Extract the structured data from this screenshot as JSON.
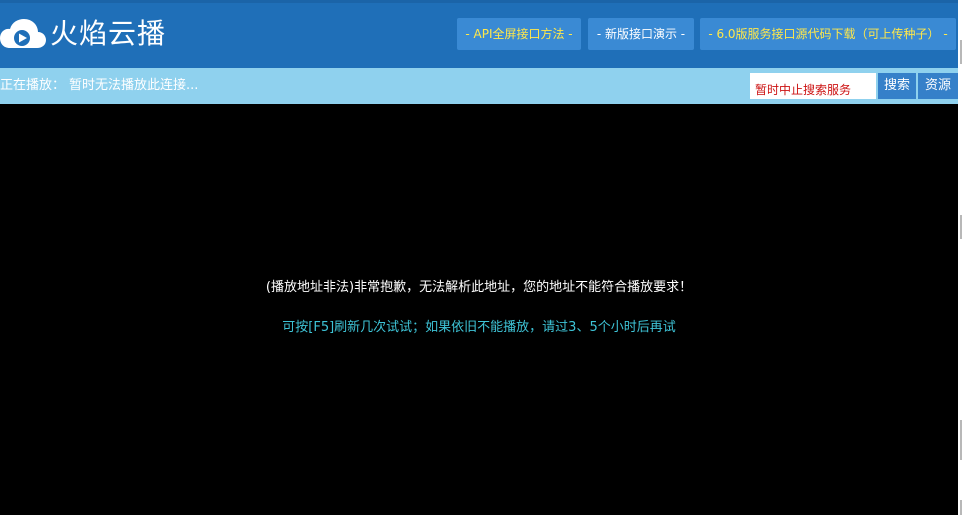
{
  "brand": {
    "logo_icon": "cloud-play-icon",
    "name": "火焰云播"
  },
  "nav": {
    "api_fullscreen": "- API全屏接口方法 -",
    "new_demo": "- 新版接口演示 -",
    "source_download": "- 6.0版服务接口源代码下载（可上传种子） -"
  },
  "status": {
    "label": "正在播放：",
    "message": "暂时无法播放此连接..."
  },
  "search": {
    "value": "暂时中止搜索服务",
    "search_button": "搜索",
    "resource_button": "资源"
  },
  "player": {
    "error_message": "(播放地址非法)非常抱歉，无法解析此地址，您的地址不能符合播放要求！",
    "hint_message": "可按[F5]刷新几次试试；如果依旧不能播放，请过3、5个小时后再试"
  },
  "colors": {
    "header_bg": "#1f6fb8",
    "nav_button_bg": "#3a8ad4",
    "nav_button_text": "#ffe84a",
    "status_bar_bg": "#8fd1ee",
    "search_text": "#cc1111",
    "player_bg": "#000000",
    "hint_text": "#3ec3d6"
  }
}
